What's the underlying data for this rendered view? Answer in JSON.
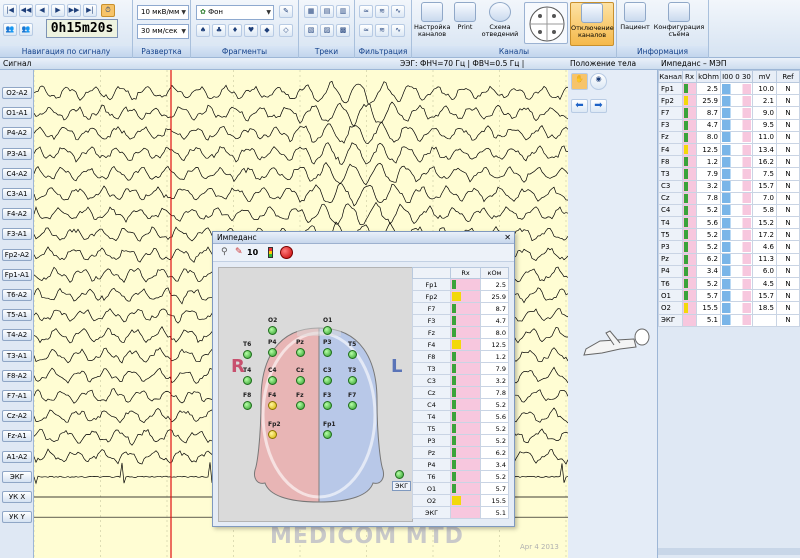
{
  "ribbon": {
    "groups": [
      {
        "id": "nav",
        "caption": "Навигация по сигналу"
      },
      {
        "id": "sweep",
        "caption": "Развертка"
      },
      {
        "id": "fragments",
        "caption": "Фрагменты"
      },
      {
        "id": "tracks",
        "caption": "Треки"
      },
      {
        "id": "filtering",
        "caption": "Фильтрация"
      },
      {
        "id": "channels",
        "caption": "Каналы"
      },
      {
        "id": "info",
        "caption": "Информация"
      }
    ],
    "timer": "0h15m20s",
    "sensitivity": "10 мкВ/мм",
    "speed": "30 мм/сек",
    "fragment": "Фон",
    "buttons": {
      "setup_channels": "Настройка каналов",
      "print": "Print",
      "lead_scheme": "Схема отведений",
      "disable_channels": "Отключение каналов",
      "patient": "Пациент",
      "recording_config": "Конфигурация съёма"
    }
  },
  "signal_bar": {
    "title": "Сигнал",
    "filters": "ЭЭГ: ФНЧ=70 Гц | ФВЧ=0.5 Гц | Режектор=50 Гц"
  },
  "channels": [
    "O2-A2",
    "O1-A1",
    "P4-A2",
    "P3-A1",
    "C4-A2",
    "C3-A1",
    "F4-A2",
    "F3-A1",
    "Fp2-A2",
    "Fp1-A1",
    "T6-A2",
    "T5-A1",
    "T4-A2",
    "T3-A1",
    "F8-A2",
    "F7-A1",
    "Cz-A2",
    "Fz-A1",
    "A1-A2",
    "ЭКГ",
    "УК X",
    "УК Y"
  ],
  "watermark": "MEDICOM MTD",
  "revision": "Apr 4 2013",
  "body_position": {
    "title": "Положение тела"
  },
  "impedance_panel": {
    "title": "Импеданс – МЭП",
    "columns": [
      "Канал",
      "Rx",
      "kOhm",
      "I00 0 30",
      "mV",
      "Ref"
    ],
    "rows": [
      {
        "ch": "Fp1",
        "kohm": "2.5",
        "mv": "10.0",
        "ref": "N",
        "rx": "#3aa33a"
      },
      {
        "ch": "Fp2",
        "kohm": "25.9",
        "mv": "2.1",
        "ref": "N",
        "rx": "#f2d90a"
      },
      {
        "ch": "F7",
        "kohm": "8.7",
        "mv": "9.0",
        "ref": "N",
        "rx": "#3aa33a"
      },
      {
        "ch": "F3",
        "kohm": "4.7",
        "mv": "9.5",
        "ref": "N",
        "rx": "#3aa33a"
      },
      {
        "ch": "Fz",
        "kohm": "8.0",
        "mv": "11.0",
        "ref": "N",
        "rx": "#3aa33a"
      },
      {
        "ch": "F4",
        "kohm": "12.5",
        "mv": "13.4",
        "ref": "N",
        "rx": "#f2d90a"
      },
      {
        "ch": "F8",
        "kohm": "1.2",
        "mv": "16.2",
        "ref": "N",
        "rx": "#3aa33a"
      },
      {
        "ch": "T3",
        "kohm": "7.9",
        "mv": "7.5",
        "ref": "N",
        "rx": "#3aa33a"
      },
      {
        "ch": "C3",
        "kohm": "3.2",
        "mv": "15.7",
        "ref": "N",
        "rx": "#3aa33a"
      },
      {
        "ch": "Cz",
        "kohm": "7.8",
        "mv": "7.0",
        "ref": "N",
        "rx": "#3aa33a"
      },
      {
        "ch": "C4",
        "kohm": "5.2",
        "mv": "5.8",
        "ref": "N",
        "rx": "#3aa33a"
      },
      {
        "ch": "T4",
        "kohm": "5.6",
        "mv": "15.2",
        "ref": "N",
        "rx": "#3aa33a"
      },
      {
        "ch": "T5",
        "kohm": "5.2",
        "mv": "17.2",
        "ref": "N",
        "rx": "#3aa33a"
      },
      {
        "ch": "P3",
        "kohm": "5.2",
        "mv": "4.6",
        "ref": "N",
        "rx": "#3aa33a"
      },
      {
        "ch": "Pz",
        "kohm": "6.2",
        "mv": "11.3",
        "ref": "N",
        "rx": "#3aa33a"
      },
      {
        "ch": "P4",
        "kohm": "3.4",
        "mv": "6.0",
        "ref": "N",
        "rx": "#3aa33a"
      },
      {
        "ch": "T6",
        "kohm": "5.2",
        "mv": "4.5",
        "ref": "N",
        "rx": "#3aa33a"
      },
      {
        "ch": "O1",
        "kohm": "5.7",
        "mv": "15.7",
        "ref": "N",
        "rx": "#3aa33a"
      },
      {
        "ch": "O2",
        "kohm": "15.5",
        "mv": "18.5",
        "ref": "N",
        "rx": "#f2d90a"
      },
      {
        "ch": "ЭКГ",
        "kohm": "5.1",
        "mv": "",
        "ref": "N",
        "rx": ""
      }
    ]
  },
  "dialog": {
    "title": "Импеданс",
    "threshold": "10",
    "side_r": "R",
    "side_l": "L",
    "ecg_label": "ЭКГ",
    "columns": [
      "",
      "Rx",
      "кОм"
    ],
    "rows": [
      {
        "ch": "Fp1",
        "kohm": "2.5",
        "rx": "#3aa33a"
      },
      {
        "ch": "Fp2",
        "kohm": "25.9",
        "rx": "#f2d90a"
      },
      {
        "ch": "F7",
        "kohm": "8.7",
        "rx": "#3aa33a"
      },
      {
        "ch": "F3",
        "kohm": "4.7",
        "rx": "#3aa33a"
      },
      {
        "ch": "Fz",
        "kohm": "8.0",
        "rx": "#3aa33a"
      },
      {
        "ch": "F4",
        "kohm": "12.5",
        "rx": "#f2d90a"
      },
      {
        "ch": "F8",
        "kohm": "1.2",
        "rx": "#3aa33a"
      },
      {
        "ch": "T3",
        "kohm": "7.9",
        "rx": "#3aa33a"
      },
      {
        "ch": "C3",
        "kohm": "3.2",
        "rx": "#3aa33a"
      },
      {
        "ch": "Cz",
        "kohm": "7.8",
        "rx": "#3aa33a"
      },
      {
        "ch": "C4",
        "kohm": "5.2",
        "rx": "#3aa33a"
      },
      {
        "ch": "T4",
        "kohm": "5.6",
        "rx": "#3aa33a"
      },
      {
        "ch": "T5",
        "kohm": "5.2",
        "rx": "#3aa33a"
      },
      {
        "ch": "P3",
        "kohm": "5.2",
        "rx": "#3aa33a"
      },
      {
        "ch": "Pz",
        "kohm": "6.2",
        "rx": "#3aa33a"
      },
      {
        "ch": "P4",
        "kohm": "3.4",
        "rx": "#3aa33a"
      },
      {
        "ch": "T6",
        "kohm": "5.2",
        "rx": "#3aa33a"
      },
      {
        "ch": "O1",
        "kohm": "5.7",
        "rx": "#3aa33a"
      },
      {
        "ch": "O2",
        "kohm": "15.5",
        "rx": "#f2d90a"
      },
      {
        "ch": "ЭКГ",
        "kohm": "5.1",
        "rx": ""
      }
    ],
    "electrodes": [
      {
        "n": "O2",
        "y": false
      },
      {
        "n": "O1",
        "y": false
      },
      {
        "n": "T6",
        "y": false
      },
      {
        "n": "P4",
        "y": false
      },
      {
        "n": "Pz",
        "y": false
      },
      {
        "n": "P3",
        "y": false
      },
      {
        "n": "T5",
        "y": false
      },
      {
        "n": "T4",
        "y": false
      },
      {
        "n": "C4",
        "y": false
      },
      {
        "n": "Cz",
        "y": false
      },
      {
        "n": "C3",
        "y": false
      },
      {
        "n": "T3",
        "y": false
      },
      {
        "n": "F8",
        "y": false
      },
      {
        "n": "F4",
        "y": true
      },
      {
        "n": "Fz",
        "y": false
      },
      {
        "n": "F3",
        "y": false
      },
      {
        "n": "F7",
        "y": false
      },
      {
        "n": "Fp2",
        "y": true
      },
      {
        "n": "Fp1",
        "y": false
      }
    ]
  },
  "colors": {
    "eeg_bg": "#fffdd3",
    "cursor": "#e01010",
    "ribbon": "#d6e3f2",
    "active_button": "#f7c46a"
  }
}
